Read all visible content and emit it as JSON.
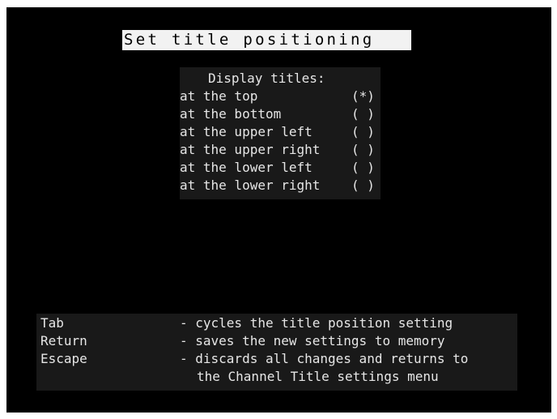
{
  "screen": {
    "title": "Set title positioning"
  },
  "options": {
    "heading": "Display titles:",
    "items": [
      {
        "label": "at the top",
        "mark": "(*)"
      },
      {
        "label": "at the bottom",
        "mark": "( )"
      },
      {
        "label": "at the upper left",
        "mark": "( )"
      },
      {
        "label": "at the upper right",
        "mark": "( )"
      },
      {
        "label": "at the lower left",
        "mark": "( )"
      },
      {
        "label": "at the lower right",
        "mark": "( )"
      }
    ]
  },
  "help": {
    "rows": [
      {
        "key": "Tab",
        "desc": "- cycles the title position setting"
      },
      {
        "key": "Return",
        "desc": "- saves the new settings to memory"
      },
      {
        "key": "Escape",
        "desc": "- discards all changes and returns to"
      }
    ],
    "continuation": "the Channel Title settings menu"
  },
  "colors": {
    "background": "#000000",
    "panel": "#191919",
    "text": "#e6e6e6",
    "title_background": "#f2f2f2"
  }
}
